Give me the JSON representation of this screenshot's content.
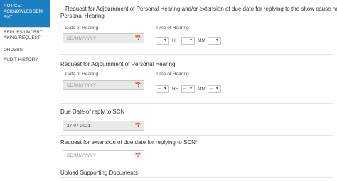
{
  "sidebar": {
    "items": [
      {
        "label": "NOTICE/ ACKNOWLEDGEM ENT",
        "active": true
      },
      {
        "label": "REPLIES/UNDERT AKING/REQUEST",
        "active": false
      },
      {
        "label": "ORDERS",
        "active": false
      },
      {
        "label": "AUDIT HISTORY",
        "active": false
      }
    ]
  },
  "page": {
    "title": "Request for Adjournment of Personal Hearing and/or extension of due date for replying to the show cause notice"
  },
  "personal_hearing": {
    "heading": "Personal Hearing",
    "date_label": "Date of Hearing",
    "date_placeholder": "DD/MM/YYYY",
    "time_label": "Time of Hearing",
    "hh_value": "--",
    "hh_unit": "HH",
    "mm_value": "--",
    "mm_unit": "MM",
    "ampm_value": "--"
  },
  "adjournment": {
    "heading": "Request for Adjournment of Personal Hearing",
    "date_label": "Date of Hearing",
    "date_placeholder": "DD/MM/YYYY",
    "time_label": "Time of Hearing",
    "hh_value": "--",
    "hh_unit": "HH",
    "mm_value": "--",
    "mm_unit": "MM",
    "ampm_value": "--"
  },
  "due_date": {
    "heading": "Due Date of reply to SCN",
    "value": "27-07-2021"
  },
  "extension": {
    "heading": "Request for extension of due date for replying to SCN",
    "required_mark": "*",
    "date_placeholder": "DD/MM/YYYY"
  },
  "upload": {
    "heading": "Upload Supporting Documents"
  },
  "icons": {
    "calendar": "calendar-icon",
    "caret": "chevron-down-icon"
  },
  "colors": {
    "active_nav": "#1b7fc1",
    "disabled_field": "#e9e9e9",
    "required": "#d12222"
  }
}
